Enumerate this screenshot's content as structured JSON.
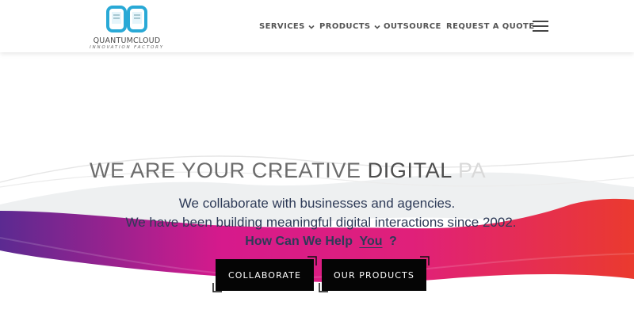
{
  "brand": {
    "name": "QUANTUMCLOUD",
    "tagline": "INNOVATION  FACTORY",
    "accent": "#29a9d6"
  },
  "nav": {
    "items": [
      {
        "label": "SERVICES",
        "dropdown": true
      },
      {
        "label": "PRODUCTS",
        "dropdown": true
      },
      {
        "label": "OUTSOURCE",
        "dropdown": false
      },
      {
        "label": "REQUEST A QUOTE",
        "dropdown": false
      }
    ],
    "menu_icon": "hamburger-icon"
  },
  "hero": {
    "headline_part1": "WE ARE YOUR CREATIVE ",
    "headline_part2": "DIGITAL",
    "headline_part3": " PA",
    "line1": "We collaborate with businesses and agencies.",
    "line2": "We have been building meaningful digital interactions since 2002.",
    "question_prefix": "How Can We Help",
    "question_highlight": "You",
    "question_suffix": "?",
    "gradient_colors": [
      "#5b2a91",
      "#e0178a",
      "#e8332c"
    ]
  },
  "buttons": {
    "collaborate": "COLLABORATE",
    "products": "OUR PRODUCTS"
  }
}
